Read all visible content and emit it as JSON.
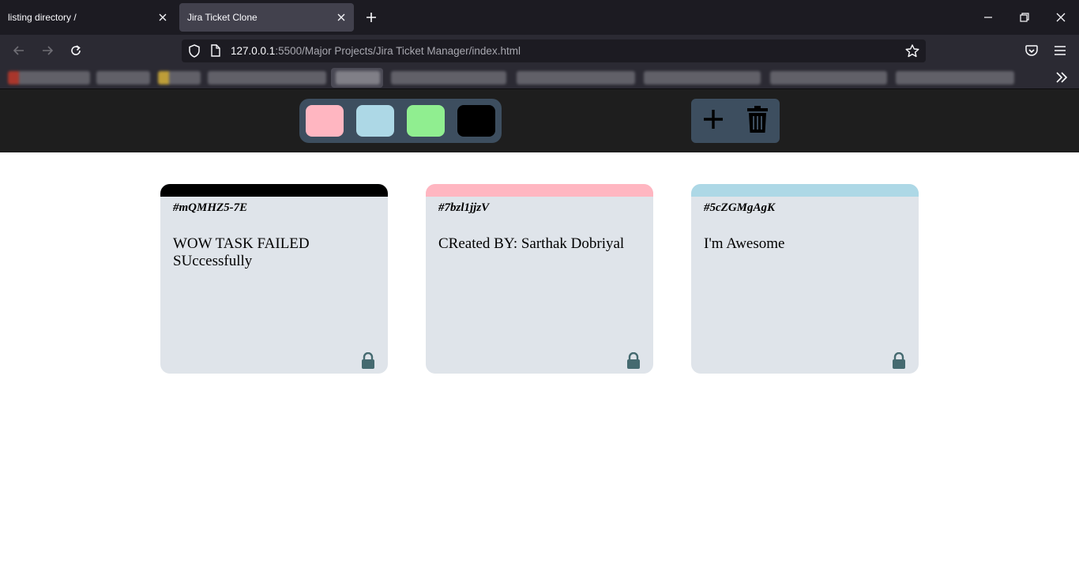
{
  "browser": {
    "tabs": [
      {
        "title": "listing directory /",
        "active": false
      },
      {
        "title": "Jira Ticket Clone",
        "active": true
      }
    ],
    "url": {
      "host": "127.0.0.1",
      "rest": ":5500/Major Projects/Jira Ticket Manager/index.html"
    }
  },
  "toolbar": {
    "colors": [
      "#ffb6c1",
      "#add8e6",
      "#90ee90",
      "#000000"
    ],
    "add_icon": "plus-icon",
    "delete_icon": "trash-icon"
  },
  "tickets": [
    {
      "id": "#mQMHZ5-7E",
      "text": "WOW TASK FAILED SUccessfully",
      "color": "#000000",
      "locked": true
    },
    {
      "id": "#7bzl1jjzV",
      "text": "CReated BY: Sarthak Dobriyal",
      "color": "#ffb6c1",
      "locked": true
    },
    {
      "id": "#5cZGMgAgK",
      "text": "I'm Awesome",
      "color": "#add8e6",
      "locked": true
    }
  ]
}
